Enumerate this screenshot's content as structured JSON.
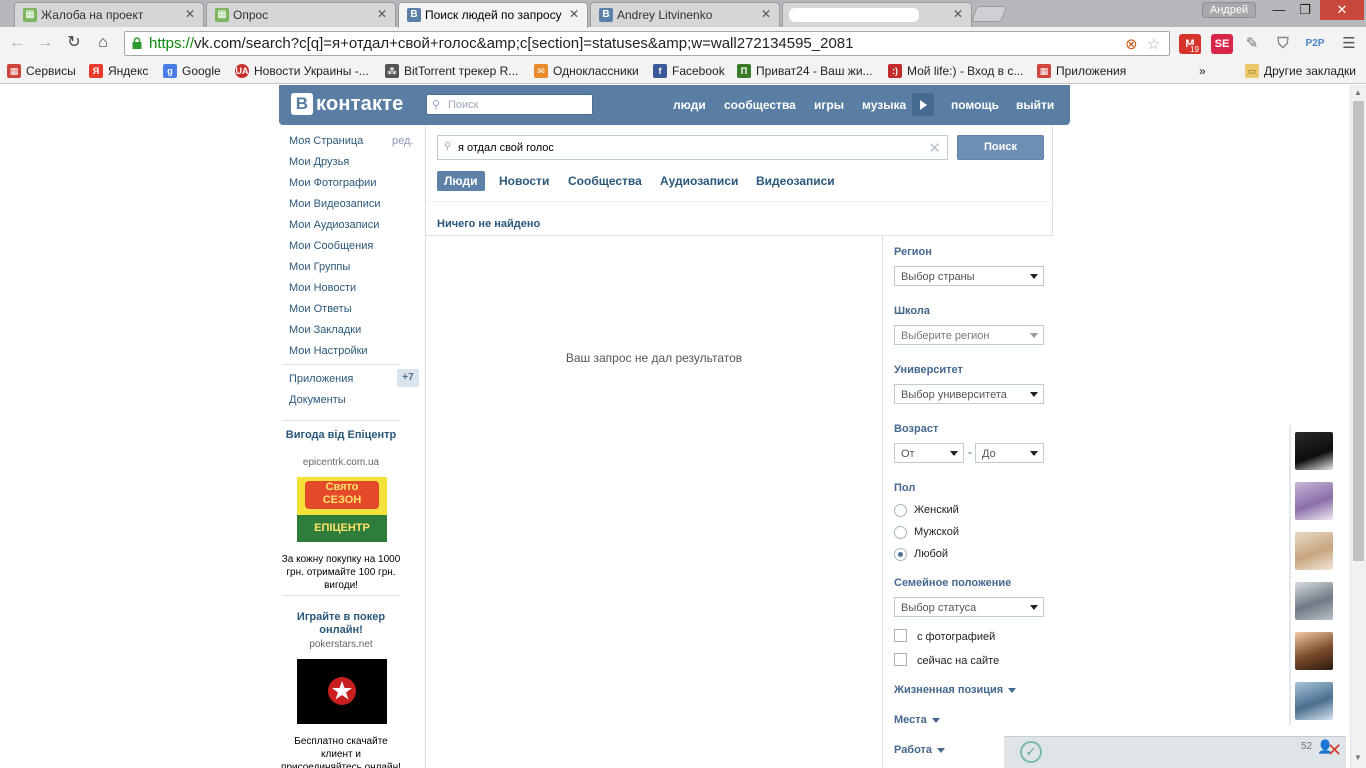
{
  "browser": {
    "tabs": [
      {
        "title": "Жалоба на проект",
        "icon": "grid-page-icon"
      },
      {
        "title": "Опрос",
        "icon": "grid-page-icon"
      },
      {
        "title": "Поиск людей по запросу",
        "icon": "vk-icon",
        "active": true
      },
      {
        "title": "Andrey Litvinenko",
        "icon": "vk-icon"
      },
      {
        "title": "",
        "icon": "blurred-icon"
      }
    ],
    "user_name": "Андрей",
    "url_scheme": "https://",
    "url_rest": "vk.com/search?c[q]=я+отдал+свой+голос&amp;c[section]=statuses&amp;w=wall272134595_2081",
    "mail_badge": "19",
    "bookmarks": [
      {
        "label": "Сервисы",
        "icon": "apps-grid-icon",
        "color": "#d0443b"
      },
      {
        "label": "Яндекс",
        "icon": "yandex-icon",
        "color": "#e53a2c"
      },
      {
        "label": "Google",
        "icon": "google-icon",
        "color": "#4a7ee6"
      },
      {
        "label": "Новости Украины -...",
        "icon": "ua-news-icon",
        "color": "#c8302a"
      },
      {
        "label": "BitTorrent трекер R...",
        "icon": "rutracker-icon",
        "color": "#555555"
      },
      {
        "label": "Одноклассники",
        "icon": "mail-envelope-icon",
        "color": "#e98b2b"
      },
      {
        "label": "Facebook",
        "icon": "facebook-icon",
        "color": "#3b5998"
      },
      {
        "label": "Приват24 - Ваш жи...",
        "icon": "privat24-icon",
        "color": "#3a7a2b"
      },
      {
        "label": "Мой life:) - Вход в с...",
        "icon": "life-icon",
        "color": "#c22b2b"
      },
      {
        "label": "Приложения",
        "icon": "apps-grid-icon",
        "color": "#d0443b"
      }
    ],
    "bookmarks_more": "»",
    "other_bookmarks": "Другие закладки"
  },
  "vk": {
    "logo_letter": "В",
    "logo_text": "контакте",
    "search_placeholder": "Поиск",
    "nav": [
      "люди",
      "сообщества",
      "игры",
      "музыка",
      "помощь",
      "выйти"
    ],
    "menu": [
      "Моя Страница",
      "Мои Друзья",
      "Мои Фотографии",
      "Мои Видеозаписи",
      "Мои Аудиозаписи",
      "Мои Сообщения",
      "Мои Группы",
      "Мои Новости",
      "Мои Ответы",
      "Мои Закладки",
      "Мои Настройки"
    ],
    "menu_edit": "ред.",
    "apps_label": "Приложения",
    "apps_badge": "+7",
    "docs_label": "Документы",
    "ads": [
      {
        "title": "Вигода від Епіцентр",
        "domain": "epicentrk.com.ua",
        "img_text_top": "Свято СЕЗОН",
        "img_text_bottom": "ЕПІЦЕНТР",
        "text": "За кожну покупку на 1000 грн. отримайте 100 грн. вигоди!"
      },
      {
        "title": "Играйте в покер онлайн!",
        "domain": "pokerstars.net",
        "text": "Бесплатно скачайте клиент и присоединяйтесь онлайн!"
      }
    ],
    "search": {
      "query": "я отдал свой голос",
      "button": "Поиск",
      "tabs": [
        "Люди",
        "Новости",
        "Сообщества",
        "Аудиозаписи",
        "Видеозаписи"
      ],
      "active_tab": "Люди",
      "summary": "Ничего не найдено",
      "empty_message": "Ваш запрос не дал результатов"
    },
    "filters": {
      "region_label": "Регион",
      "region_value": "Выбор страны",
      "school_label": "Школа",
      "school_value": "Выберите регион",
      "university_label": "Университет",
      "university_value": "Выбор университета",
      "age_label": "Возраст",
      "age_from": "От",
      "age_dash": "-",
      "age_to": "До",
      "sex_label": "Пол",
      "sex_options": [
        "Женский",
        "Мужской",
        "Любой"
      ],
      "sex_selected": "Любой",
      "status_label": "Семейное положение",
      "status_value": "Выбор статуса",
      "with_photo": "с фотографией",
      "online_now": "сейчас на сайте",
      "life_position": "Жизненная позиция",
      "places": "Места",
      "work": "Работа"
    }
  },
  "notification": {
    "count": "52"
  },
  "colors": {
    "vk_blue": "#597da3",
    "vk_link": "#2b587a",
    "tab_active": "#5e81a8"
  }
}
